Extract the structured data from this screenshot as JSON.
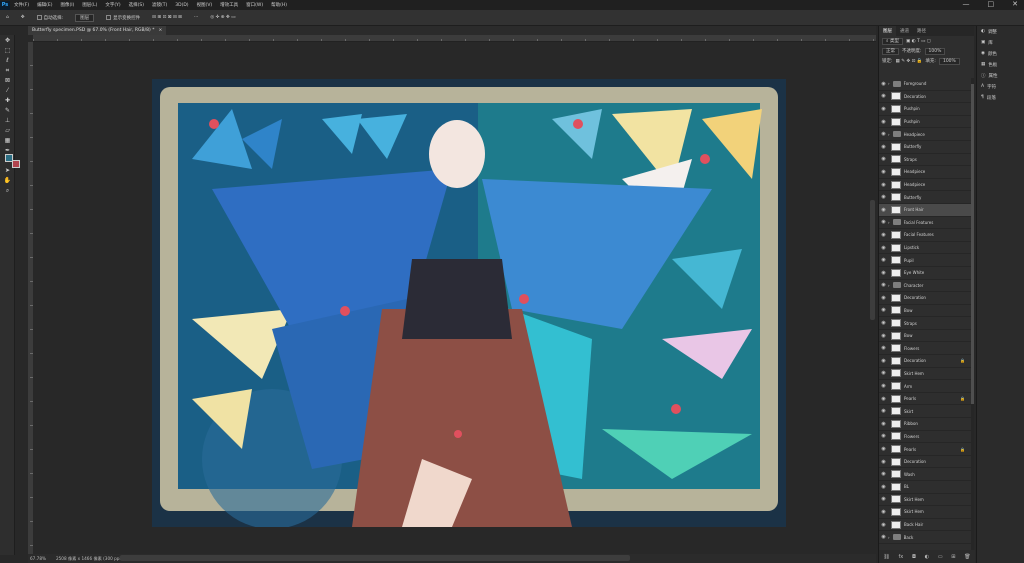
{
  "menubar": {
    "app_icon": "Ps",
    "items": [
      "文件(F)",
      "编辑(E)",
      "图像(I)",
      "图层(L)",
      "文字(Y)",
      "选择(S)",
      "滤镜(T)",
      "3D(D)",
      "视图(V)",
      "增效工具",
      "窗口(W)",
      "帮助(H)"
    ],
    "window_controls": [
      "—",
      "□",
      "✕"
    ]
  },
  "options": {
    "auto_select_label": "自动选择:",
    "auto_select_value": "图层",
    "transform_label": "显示变换控件",
    "more": "···"
  },
  "document": {
    "tab_title": "Butterfly specimen.PSD @ 67.0% (Front Hair, RGB/8) *",
    "close": "×"
  },
  "status": {
    "zoom": "67.78%",
    "info": "2508 像素 x 1466 像素 (300 ppi)"
  },
  "panel": {
    "tabs": [
      "图层",
      "通道",
      "路径"
    ],
    "filter_label": "类型",
    "blend_mode": "正常",
    "opacity_label": "不透明度:",
    "opacity": "100%",
    "lock_label": "锁定:",
    "fill_label": "填充:",
    "fill": "100%",
    "layers": [
      {
        "name": "Foreground",
        "type": "group"
      },
      {
        "name": "Decoration",
        "type": "layer"
      },
      {
        "name": "Pushpin",
        "type": "layer"
      },
      {
        "name": "Pushpin",
        "type": "layer"
      },
      {
        "name": "Headpiece",
        "type": "group"
      },
      {
        "name": "Butterfly",
        "type": "layer"
      },
      {
        "name": "Straps",
        "type": "layer"
      },
      {
        "name": "Headpiece",
        "type": "layer"
      },
      {
        "name": "Headpiece",
        "type": "layer"
      },
      {
        "name": "Butterfly",
        "type": "layer"
      },
      {
        "name": "Front Hair",
        "type": "layer",
        "selected": true
      },
      {
        "name": "Facial Features",
        "type": "group"
      },
      {
        "name": "Facial Features",
        "type": "layer"
      },
      {
        "name": "Lipstick",
        "type": "layer"
      },
      {
        "name": "Pupil",
        "type": "layer"
      },
      {
        "name": "Eye White",
        "type": "layer"
      },
      {
        "name": "Character",
        "type": "group"
      },
      {
        "name": "Decoration",
        "type": "layer"
      },
      {
        "name": "Bow",
        "type": "layer"
      },
      {
        "name": "Straps",
        "type": "layer"
      },
      {
        "name": "Bow",
        "type": "layer"
      },
      {
        "name": "Flowers",
        "type": "layer"
      },
      {
        "name": "Decoration",
        "type": "layer",
        "locked": true
      },
      {
        "name": "Skirt Hem",
        "type": "layer"
      },
      {
        "name": "Arm",
        "type": "layer"
      },
      {
        "name": "Pearls",
        "type": "layer",
        "locked": true
      },
      {
        "name": "Skirt",
        "type": "layer"
      },
      {
        "name": "Ribbon",
        "type": "layer"
      },
      {
        "name": "Flowers",
        "type": "layer"
      },
      {
        "name": "Pearls",
        "type": "layer",
        "locked": true
      },
      {
        "name": "Decoration",
        "type": "layer"
      },
      {
        "name": "Wash",
        "type": "layer"
      },
      {
        "name": "BL",
        "type": "layer"
      },
      {
        "name": "Skirt Hem",
        "type": "layer"
      },
      {
        "name": "Skirt Hem",
        "type": "layer"
      },
      {
        "name": "Back Hair",
        "type": "layer"
      },
      {
        "name": "Back",
        "type": "group"
      }
    ],
    "bottom_icons": [
      "link-icon",
      "fx-icon",
      "mask-icon",
      "adjustment-icon",
      "group-icon",
      "new-layer-icon",
      "trash-icon"
    ]
  },
  "side_panel": {
    "items": [
      "调整",
      "库",
      "颜色",
      "色板",
      "属性",
      "字符",
      "段落"
    ]
  },
  "colors": {
    "foreground": "#2c6f84",
    "background": "#b2444e",
    "accent": "#31a8ff"
  }
}
